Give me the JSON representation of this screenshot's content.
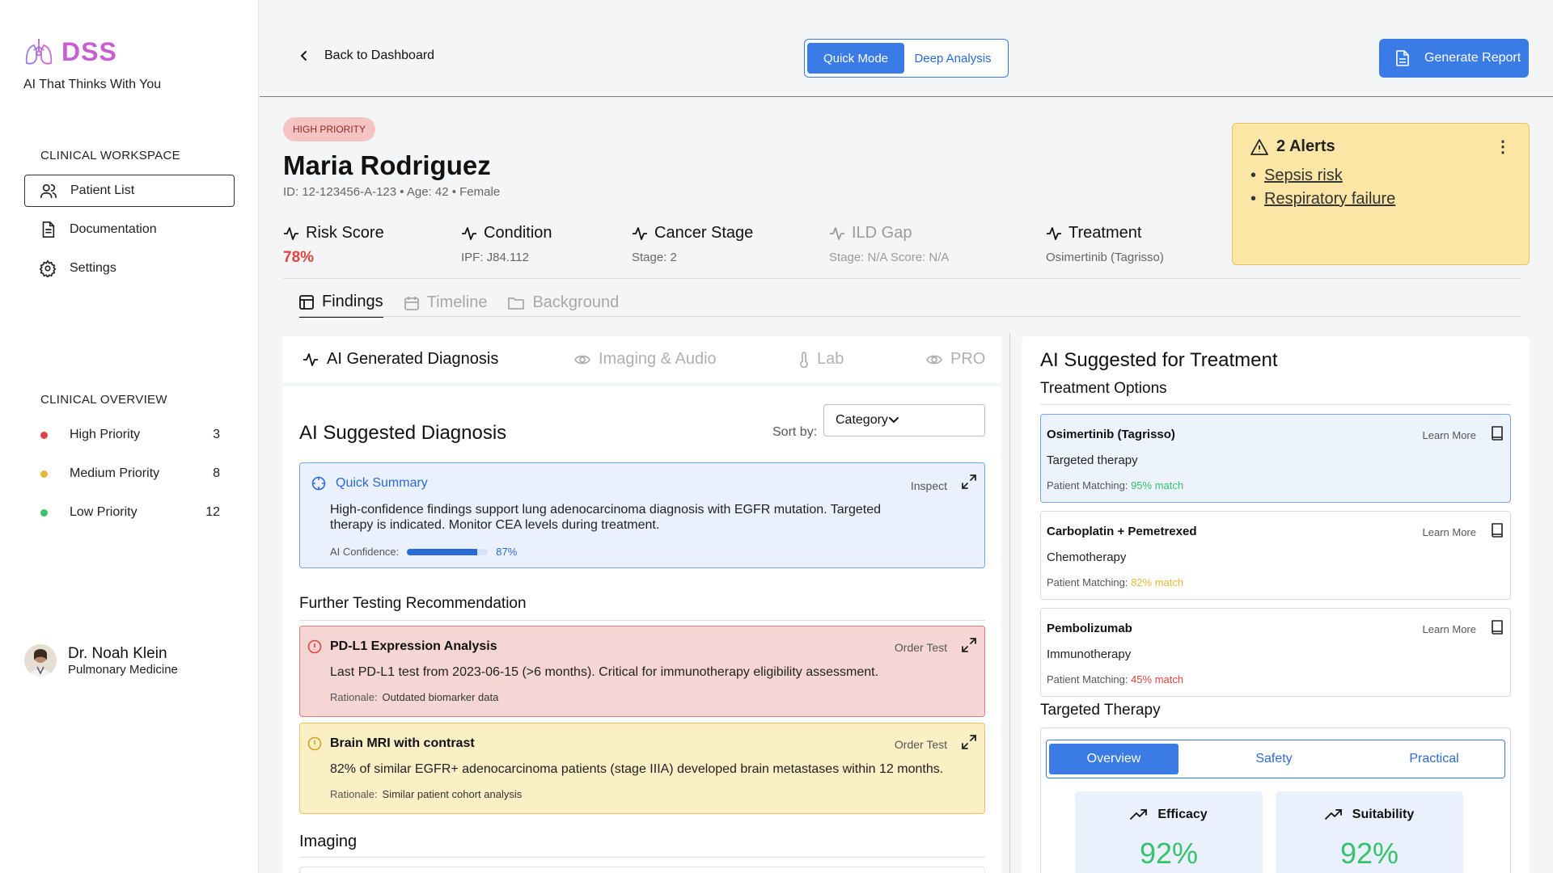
{
  "app": {
    "logo_text": "DSS",
    "tagline": "AI That Thinks With You"
  },
  "sidebar": {
    "workspace_title": "CLINICAL WORKSPACE",
    "nav": [
      {
        "label": "Patient List",
        "icon": "users-icon",
        "active": true
      },
      {
        "label": "Documentation",
        "icon": "document-icon",
        "active": false
      },
      {
        "label": "Settings",
        "icon": "gear-icon",
        "active": false
      }
    ],
    "overview_title": "CLINICAL OVERVIEW",
    "priorities": [
      {
        "label": "High Priority",
        "count": "3",
        "color": "#e0433e"
      },
      {
        "label": "Medium Priority",
        "count": "8",
        "color": "#e2b93b"
      },
      {
        "label": "Low Priority",
        "count": "12",
        "color": "#34c26a"
      }
    ],
    "doctor": {
      "name": "Dr. Noah Klein",
      "specialty": "Pulmonary Medicine"
    }
  },
  "topbar": {
    "back_label": "Back to Dashboard",
    "modes": [
      "Quick Mode",
      "Deep Analysis"
    ],
    "active_mode": "Quick Mode",
    "generate_label": "Generate Report"
  },
  "patient": {
    "priority_badge": "HIGH PRIORITY",
    "name": "Maria Rodriguez",
    "meta": "ID: 12-123456-A-123  •  Age: 42  •  Female",
    "stats": [
      {
        "title": "Risk Score",
        "value": "78%"
      },
      {
        "title": "Condition",
        "value": "IPF: J84.112"
      },
      {
        "title": "Cancer Stage",
        "value": "Stage:  2"
      },
      {
        "title": "ILD Gap",
        "value": "Stage:  N/A   Score:  N/A"
      },
      {
        "title": "Treatment",
        "value": "Osimertinib (Tagrisso)"
      }
    ]
  },
  "alerts": {
    "title": "2 Alerts",
    "items": [
      "Sepsis risk",
      "Respiratory failure"
    ]
  },
  "main_tabs": [
    "Findings",
    "Timeline",
    "Background"
  ],
  "active_main_tab": "Findings",
  "sub_tabs": [
    "AI Generated Diagnosis",
    "Imaging & Audio",
    "Lab",
    "PRO"
  ],
  "diagnosis": {
    "title": "AI Suggested Diagnosis",
    "sort_label": "Sort by:",
    "sort_value": "Category",
    "summary": {
      "title": "Quick Summary",
      "action": "Inspect",
      "body": "High-confidence findings support lung adenocarcinoma diagnosis with EGFR mutation. Targeted therapy is indicated. Monitor CEA levels during treatment.",
      "confidence_label": "AI Confidence:",
      "confidence_value": "87%",
      "confidence_fraction": 0.87
    },
    "further_title": "Further Testing Recommendation",
    "tests": [
      {
        "title": "PD-L1 Expression Analysis",
        "action": "Order Test",
        "body": "Last PD-L1 test from 2023-06-15 (>6 months). Critical for immunotherapy eligibility assessment.",
        "rationale_label": "Rationale:",
        "rationale": "Outdated biomarker data"
      },
      {
        "title": "Brain MRI with contrast",
        "action": "Order Test",
        "body": "82% of similar EGFR+ adenocarcinoma patients (stage IIIA) developed brain metastases within 12 months.",
        "rationale_label": "Rationale:",
        "rationale": "Similar patient cohort analysis"
      }
    ],
    "imaging_title": "Imaging"
  },
  "treatment": {
    "title": "AI Suggested for Treatment",
    "options_title": "Treatment Options",
    "options": [
      {
        "name": "Osimertinib (Tagrisso)",
        "type": "Targeted therapy",
        "match_label": "Patient Matching:",
        "match": "95% match",
        "match_color": "#34c26a",
        "learn": "Learn More"
      },
      {
        "name": "Carboplatin + Pemetrexed",
        "type": "Chemotherapy",
        "match_label": "Patient Matching:",
        "match": "82% match",
        "match_color": "#e2b93b",
        "learn": "Learn More"
      },
      {
        "name": "Pembolizumab",
        "type": "Immunotherapy",
        "match_label": "Patient Matching:",
        "match": "45% match",
        "match_color": "#e0433e",
        "learn": "Learn More"
      }
    ],
    "targeted_title": "Targeted Therapy",
    "targeted_tabs": [
      "Overview",
      "Safety",
      "Practical"
    ],
    "metrics": [
      {
        "label": "Efficacy",
        "value": "92%"
      },
      {
        "label": "Suitability",
        "value": "92%"
      }
    ]
  }
}
